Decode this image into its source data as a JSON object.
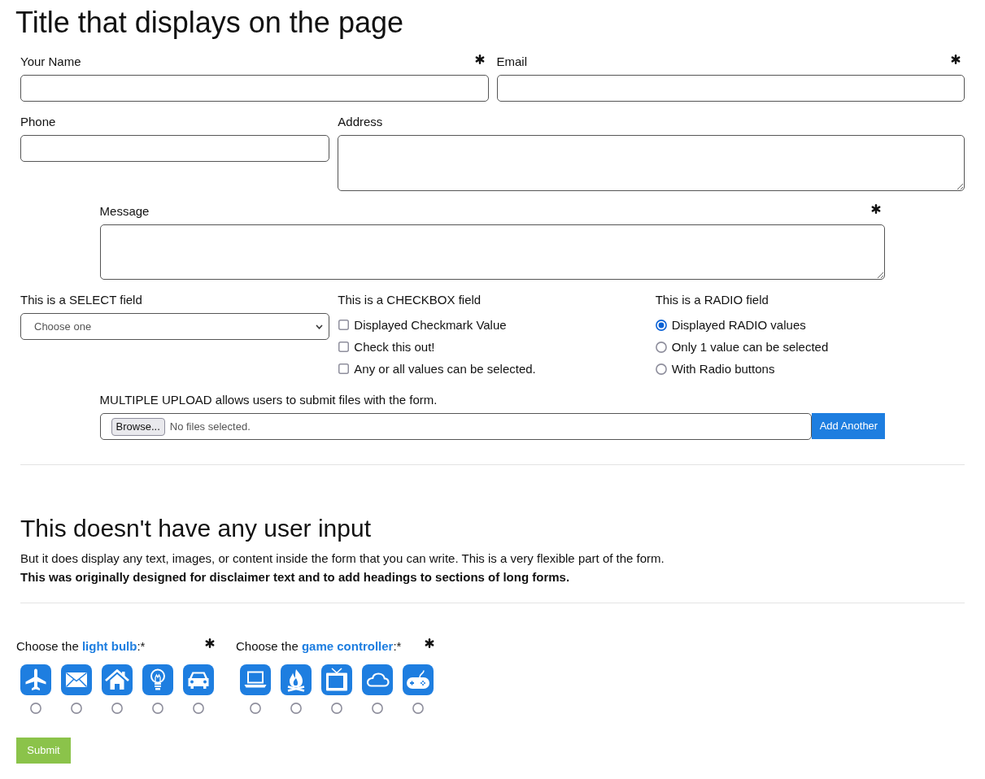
{
  "title": "Title that displays on the page",
  "fields": [
    {
      "kind": "text",
      "label": "Your Name",
      "required": true
    },
    {
      "kind": "text",
      "label": "Email",
      "required": true
    },
    {
      "kind": "text",
      "label": "Phone",
      "required": false
    },
    {
      "kind": "textarea",
      "label": "Address",
      "required": false
    },
    {
      "kind": "textarea",
      "label": "Message",
      "required": true
    },
    {
      "kind": "select",
      "label": "This is a SELECT field",
      "required": false,
      "value": "Choose one"
    },
    {
      "kind": "checkbox",
      "label": "This is a CHECKBOX field",
      "required": false,
      "options": [
        {
          "label": "Displayed Checkmark Value",
          "checked": false
        },
        {
          "label": "Check this out!",
          "checked": false
        },
        {
          "label": "Any or all values can be selected.",
          "checked": false
        }
      ]
    },
    {
      "kind": "radio",
      "label": "This is a RADIO field",
      "required": false,
      "options": [
        {
          "label": "Displayed RADIO values",
          "selected": true
        },
        {
          "label": "Only 1 value can be selected",
          "selected": false
        },
        {
          "label": "With Radio buttons",
          "selected": false
        }
      ]
    },
    {
      "kind": "upload",
      "label": "MULTIPLE UPLOAD allows users to submit files with the form.",
      "required": false,
      "button": "Browse...",
      "status": "No files selected.",
      "add_button": "Add Another"
    }
  ],
  "info": {
    "heading": "This doesn't have any user input",
    "text": "But it does display any text, images, or content inside the form that you can write. This is a very flexible part of the form.",
    "note": "This was originally designed for disclaimer text and to add headings to sections of long forms."
  },
  "image_choices": [
    {
      "prompt": "Choose the **light bulb**:*",
      "required": true,
      "options": [
        {
          "selected": false
        },
        {
          "selected": false
        },
        {
          "selected": false
        },
        {
          "selected": false
        },
        {
          "selected": false
        }
      ]
    },
    {
      "prompt": "Choose the **game controller**:*",
      "required": true,
      "options": [
        {
          "selected": false
        },
        {
          "selected": false
        },
        {
          "selected": false
        },
        {
          "selected": false
        },
        {
          "selected": false
        }
      ]
    }
  ],
  "submit": "Submit"
}
